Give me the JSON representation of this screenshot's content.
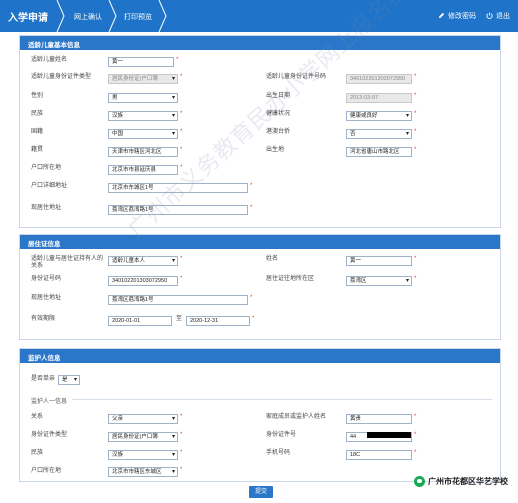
{
  "nav": {
    "home": "入学申请",
    "crumbs": [
      "网上确认",
      "打印预览"
    ],
    "change_password": "修改密码",
    "logout": "退出"
  },
  "child_panel": {
    "title": "适龄儿童基本信息",
    "name_label": "适龄儿童姓名",
    "name_value": "黄一",
    "idtype_label": "适龄儿童身份证件类型",
    "idtype_value": "居民身份证(户口簿",
    "idno_label": "适龄儿童身份证件号码",
    "idno_value": "340102201303072950",
    "gender_label": "性别",
    "gender_value": "男",
    "birthdate_label": "出生日期",
    "birthdate_value": "2013-03-07",
    "ethnic_label": "民族",
    "ethnic_value": "汉族",
    "health_label": "健康状况",
    "health_value": "健康或良好",
    "nationality_label": "国籍",
    "nationality_value": "中国",
    "hkmt_label": "港澳台侨",
    "hkmt_value": "否",
    "native_label": "籍贯",
    "native_value": "天津市市辖区河北区",
    "birthplace_label": "出生地",
    "birthplace_value": "河北省唐山市路北区",
    "hukou_label": "户口所在地",
    "hukou_value": "北京市市县延庆县",
    "hukou_addr_label": "户口详细地址",
    "hukou_addr_value": "北京市东城区1号",
    "current_addr_label": "现居住地址",
    "current_addr_value": "荔湾区荔湾路1号"
  },
  "residence_panel": {
    "title": "居住证信息",
    "relation_label": "适龄儿童与居住证持有人的关系",
    "relation_value": "适龄儿童本人",
    "holder_name_label": "姓名",
    "holder_name_value": "黄一",
    "idno_label": "身份证号码",
    "idno_value": "340102201303072950",
    "issue_area_label": "居住证往地所在区",
    "issue_area_value": "荔湾区",
    "addr_label": "现居住地址",
    "addr_value": "荔湾区荔湾路1号",
    "valid_label": "有效期限",
    "valid_from": "2020-01-01",
    "valid_to_sep": "至",
    "valid_to": "2020-12-31"
  },
  "guardian_panel": {
    "title": "监护人信息",
    "single_parent_label": "是否单亲",
    "single_parent_value": "是",
    "fieldset_title": "监护人一信息",
    "relation_label": "关系",
    "relation_value": "父亲",
    "family_name_label": "家庭成员或监护人姓名",
    "family_name_value": "黄贵",
    "idtype_label": "身份证件类型",
    "idtype_value": "居民身份证(户口簿",
    "idno_label": "身份证件号",
    "idno_value": "44",
    "ethnic_label": "民族",
    "ethnic_value": "汉族",
    "phone_label": "手机号码",
    "phone_value": "18C",
    "hukou_label": "户口所在地",
    "hukou_value": "北京市市辖区东城区"
  },
  "submit_label": "提交",
  "watermark": "广州市义务教育民办小学网上报名操作指引",
  "brand": "广州市花都区华艺学校",
  "colors": {
    "nav": "#1f73c8",
    "panel_head": "#2a77c9",
    "required": "#e23b3b"
  }
}
